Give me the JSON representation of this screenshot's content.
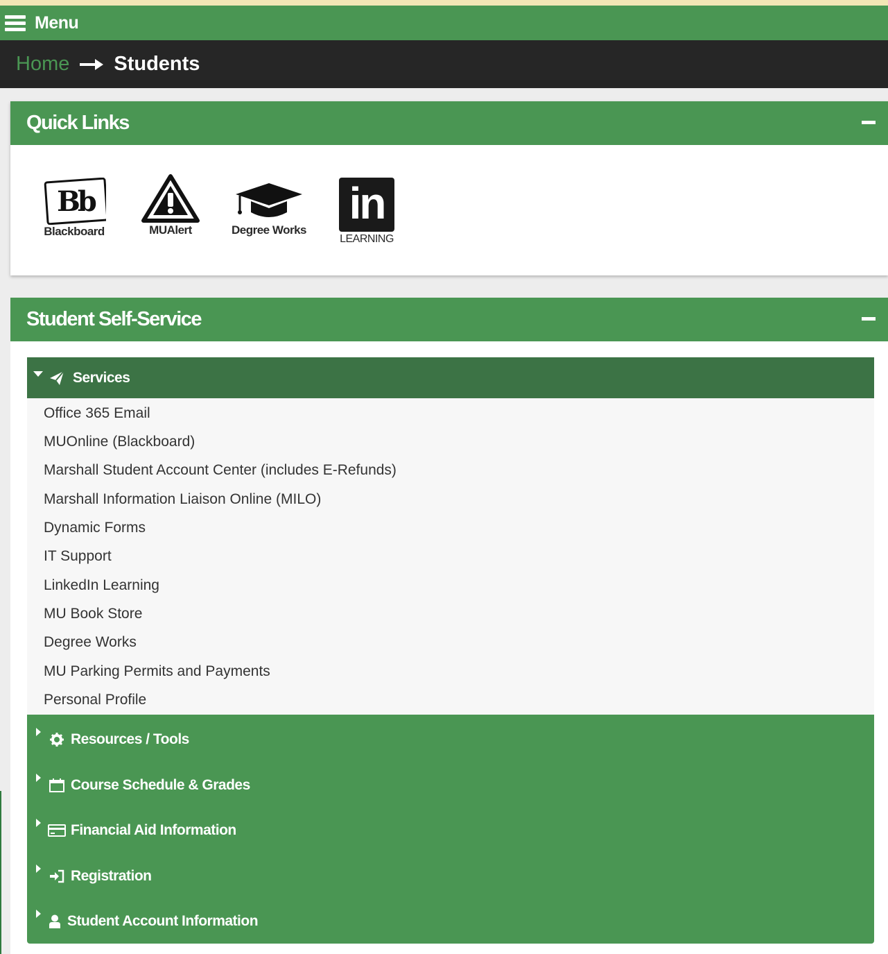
{
  "menu": {
    "label": "Menu"
  },
  "breadcrumb": {
    "home": "Home",
    "current": "Students"
  },
  "quick_links": {
    "title": "Quick Links",
    "items": [
      {
        "label": "Blackboard",
        "icon": "blackboard-icon"
      },
      {
        "label": "MUAlert",
        "icon": "alert-icon"
      },
      {
        "label": "Degree Works",
        "icon": "graduation-cap-icon"
      },
      {
        "label": "LEARNING",
        "icon": "linkedin-icon",
        "logo_text": "in"
      }
    ]
  },
  "self_service": {
    "title": "Student Self-Service",
    "open_section": {
      "label": "Services",
      "icon": "paper-plane-icon",
      "items": [
        "Office 365 Email",
        "MUOnline (Blackboard)",
        "Marshall Student Account Center (includes E-Refunds)",
        "Marshall Information Liaison Online (MILO)",
        "Dynamic Forms",
        "IT Support",
        "LinkedIn Learning",
        "MU Book Store",
        "Degree Works",
        "MU Parking Permits and Payments",
        "Personal Profile"
      ]
    },
    "closed_sections": [
      {
        "label": "Resources / Tools",
        "icon": "gear-icon"
      },
      {
        "label": "Course Schedule & Grades",
        "icon": "calendar-icon"
      },
      {
        "label": "Financial Aid Information",
        "icon": "credit-card-icon"
      },
      {
        "label": "Registration",
        "icon": "sign-in-icon"
      },
      {
        "label": "Student Account Information",
        "icon": "user-icon"
      }
    ]
  },
  "colors": {
    "green": "#4a9653",
    "dark_green": "#3c7345",
    "breadcrumb_bg": "#262626"
  }
}
